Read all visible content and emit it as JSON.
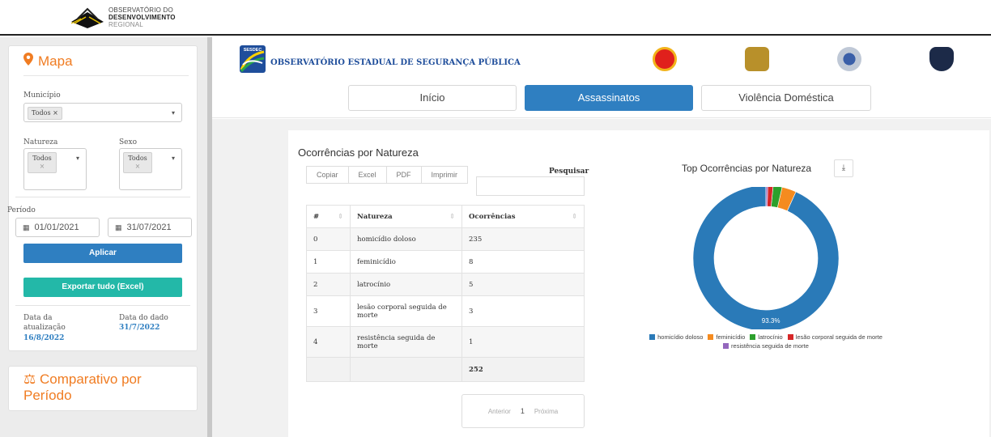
{
  "brand": {
    "line1": "OBSERVATÓRIO DO",
    "line2": "DESENVOLVIMENTO",
    "line3": "REGIONAL"
  },
  "sidebar": {
    "mapa_title": "Mapa",
    "municipio_label": "Município",
    "municipio_tag": "Todos ×",
    "natureza_label": "Natureza",
    "natureza_tag_text": "Todos",
    "natureza_tag_x": "×",
    "sexo_label": "Sexo",
    "sexo_tag_text": "Todos",
    "sexo_tag_x": "×",
    "periodo_label": "Período",
    "date_start": "01/01/2021",
    "date_end": "31/07/2021",
    "apply_label": "Aplicar",
    "export_label": "Exportar tudo (Excel)",
    "update_label_1": "Data da",
    "update_label_2": "atualização",
    "update_value": "16/8/2022",
    "data_label": "Data do dado",
    "data_value": "31/7/2022",
    "comparativo_title_1": "Comparativo por",
    "comparativo_title_2": "Período"
  },
  "header": {
    "sesdec_badge": "SESDEC",
    "title": "OBSERVATÓRIO ESTADUAL DE SEGURANÇA PÚBLICA",
    "nav": [
      {
        "label": "Início",
        "active": false
      },
      {
        "label": "Assassinatos",
        "active": true
      },
      {
        "label": "Violência Doméstica",
        "active": false
      }
    ]
  },
  "table_section": {
    "title": "Ocorrências por Natureza",
    "buttons": [
      "Copiar",
      "Excel",
      "PDF",
      "Imprimir"
    ],
    "search_label": "Pesquisar",
    "columns": [
      "#",
      "Natureza",
      "Ocorrências"
    ],
    "rows": [
      {
        "idx": "0",
        "natureza": "homicídio doloso",
        "ocorrencias": "235"
      },
      {
        "idx": "1",
        "natureza": "feminicídio",
        "ocorrencias": "8"
      },
      {
        "idx": "2",
        "natureza": "latrocínio",
        "ocorrencias": "5"
      },
      {
        "idx": "3",
        "natureza": "lesão corporal seguida de morte",
        "ocorrencias": "3"
      },
      {
        "idx": "4",
        "natureza": "resistência seguida de morte",
        "ocorrencias": "1"
      }
    ],
    "total": "252",
    "pager_prev": "Anterior",
    "pager_page": "1",
    "pager_next": "Próxima"
  },
  "chart_section": {
    "title": "Top Ocorrências por Natureza",
    "download_icon": "download-icon"
  },
  "colors": {
    "accent_orange": "#f07c22",
    "primary_blue": "#2f7fc1",
    "teal": "#23b8a8"
  },
  "chart_data": {
    "type": "pie",
    "variant": "donut",
    "title": "Top Ocorrências por Natureza",
    "categories": [
      "homicídio doloso",
      "feminicídio",
      "latrocínio",
      "lesão corporal seguida de morte",
      "resistência seguida de morte"
    ],
    "values": [
      235,
      8,
      5,
      3,
      1
    ],
    "colors": [
      "#2a7ab8",
      "#f58b1f",
      "#2ca02c",
      "#d62728",
      "#9467bd"
    ],
    "data_labels": [
      "93.3%"
    ],
    "legend_position": "bottom"
  }
}
